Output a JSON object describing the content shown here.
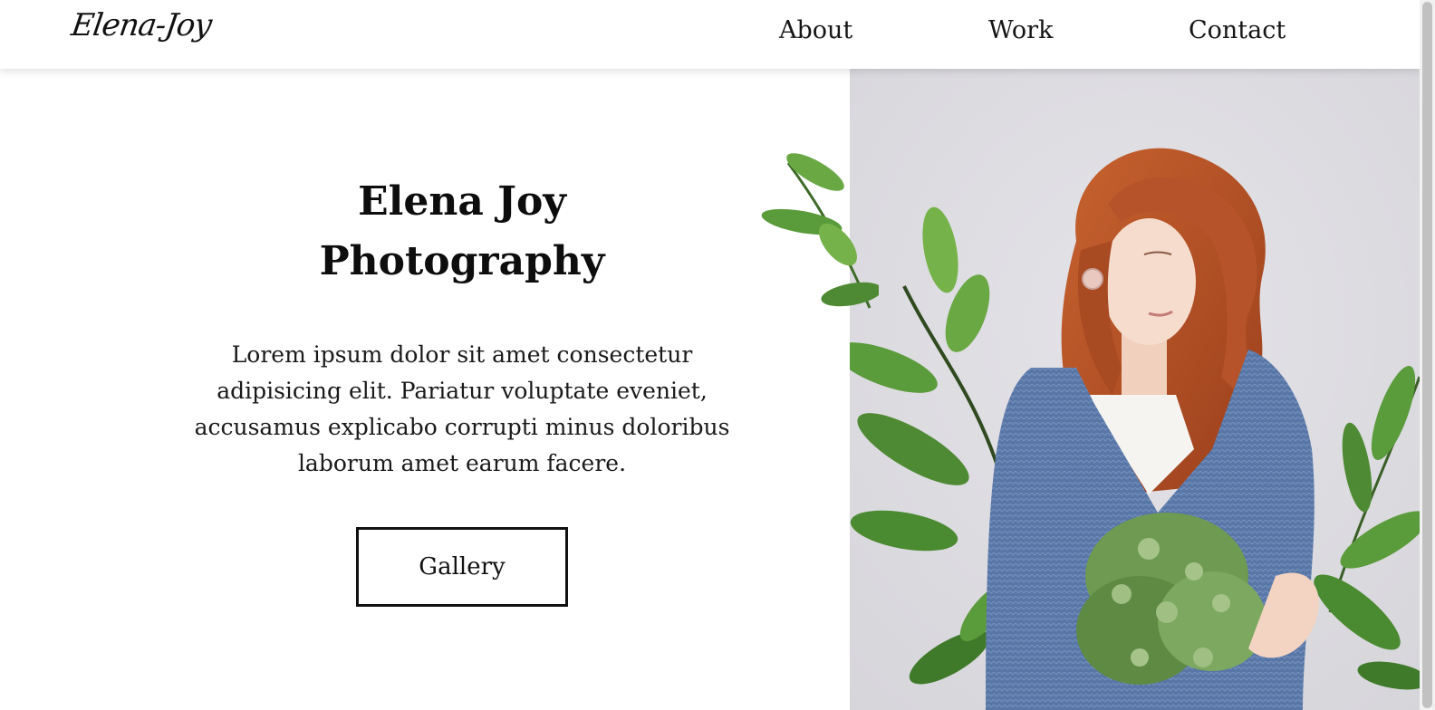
{
  "header": {
    "logo": "Elena-Joy",
    "nav": {
      "about": "About",
      "work": "Work",
      "contact": "Contact"
    }
  },
  "hero": {
    "title_line1": "Elena Joy",
    "title_line2": "Photography",
    "description": "Lorem ipsum dolor sit amet consectetur adipisicing elit. Pariatur voluptate eveniet, accusamus explicabo corrupti minus doloribus laborum amet earum facere.",
    "button_label": "Gallery"
  },
  "colors": {
    "photo_background": "#dcdbe0",
    "hair": "#b9532a",
    "cardigan": "#5a78a8",
    "leaf": "#5f9a3d"
  }
}
